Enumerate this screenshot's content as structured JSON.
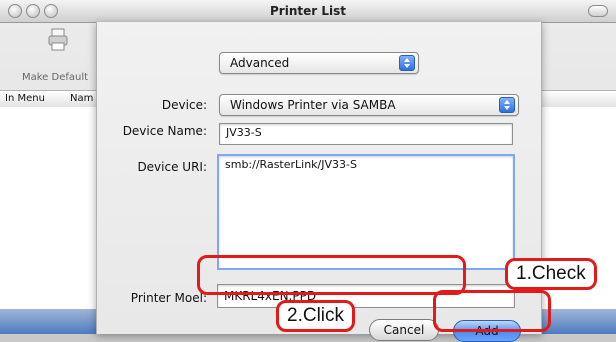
{
  "window": {
    "title": "Printer List",
    "toolbar": {
      "make_default_label": "Make Default"
    },
    "columns": [
      "In Menu",
      "Nam"
    ]
  },
  "sheet": {
    "mode_popup": "Advanced",
    "device_label": "Device:",
    "device_value": "Windows Printer via SAMBA",
    "device_name_label": "Device Name:",
    "device_name_value": "JV33-S",
    "device_uri_label": "Device URI:",
    "device_uri_value": "smb://RasterLink/JV33-S",
    "printer_model_label": "Printer Mo​el:",
    "printer_model_value": "MKRL4xEN.PPD",
    "cancel_label": "Cancel",
    "add_label": "Add"
  },
  "annotations": {
    "check_label": "1.Check",
    "click_label": "2.Click",
    "highlight_color": "#e21a1a"
  }
}
